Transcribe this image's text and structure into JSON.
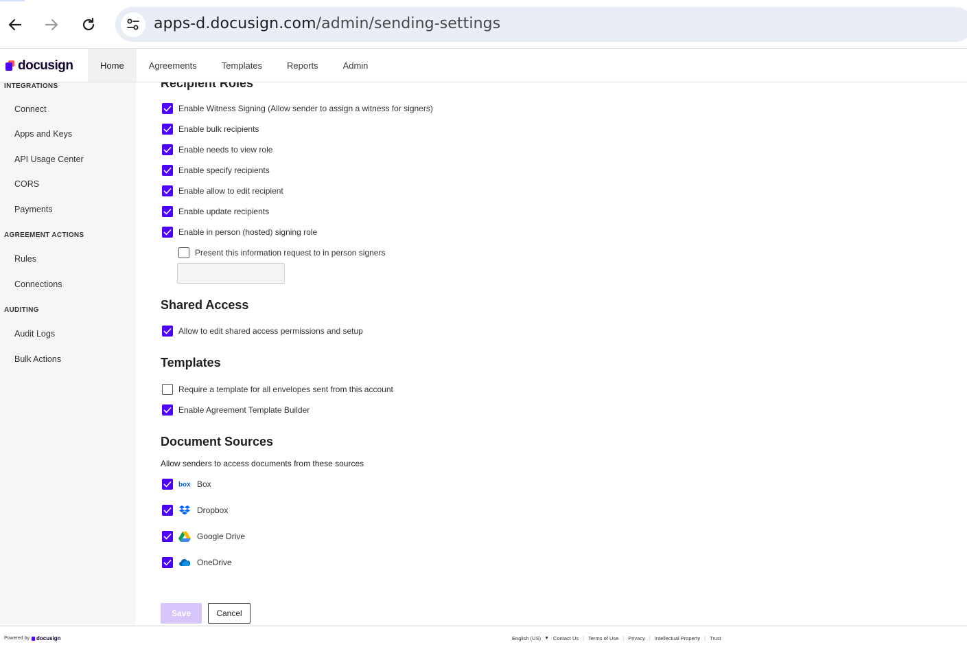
{
  "browser": {
    "url_host": "apps-d.docusign.com",
    "url_path": "/admin/sending-settings"
  },
  "header": {
    "logo_text": "docusign",
    "tabs": [
      {
        "label": "Home",
        "active": true
      },
      {
        "label": "Agreements",
        "active": false
      },
      {
        "label": "Templates",
        "active": false
      },
      {
        "label": "Reports",
        "active": false
      },
      {
        "label": "Admin",
        "active": false
      }
    ]
  },
  "sidebar": {
    "integrations_heading": "INTEGRATIONS",
    "integrations_items": [
      "Connect",
      "Apps and Keys",
      "API Usage Center",
      "CORS",
      "Payments"
    ],
    "agreement_actions_heading": "AGREEMENT ACTIONS",
    "agreement_actions_items": [
      "Rules",
      "Connections"
    ],
    "auditing_heading": "AUDITING",
    "auditing_items": [
      "Audit Logs",
      "Bulk Actions"
    ]
  },
  "recipient_roles": {
    "title": "Recipient Roles",
    "options": [
      {
        "label": "Enable Witness Signing (Allow sender to assign a witness for signers)",
        "checked": true
      },
      {
        "label": "Enable bulk recipients",
        "checked": true
      },
      {
        "label": "Enable needs to view role",
        "checked": true
      },
      {
        "label": "Enable specify recipients",
        "checked": true
      },
      {
        "label": "Enable allow to edit recipient",
        "checked": true
      },
      {
        "label": "Enable update recipients",
        "checked": true
      },
      {
        "label": "Enable in person (hosted) signing role",
        "checked": true
      }
    ],
    "sub_option": {
      "label": "Present this information request to in person signers",
      "checked": false
    },
    "sub_input_value": ""
  },
  "shared_access": {
    "title": "Shared Access",
    "options": [
      {
        "label": "Allow to edit shared access permissions and setup",
        "checked": true
      }
    ]
  },
  "templates": {
    "title": "Templates",
    "options": [
      {
        "label": "Require a template for all envelopes sent from this account",
        "checked": false
      },
      {
        "label": "Enable Agreement Template Builder",
        "checked": true
      }
    ]
  },
  "document_sources": {
    "title": "Document Sources",
    "subtitle": "Allow senders to access documents from these sources",
    "sources": [
      {
        "label": "Box",
        "icon": "box-icon",
        "checked": true
      },
      {
        "label": "Dropbox",
        "icon": "dropbox-icon",
        "checked": true
      },
      {
        "label": "Google Drive",
        "icon": "google-drive-icon",
        "checked": true
      },
      {
        "label": "OneDrive",
        "icon": "onedrive-icon",
        "checked": true
      }
    ]
  },
  "actions": {
    "save_label": "Save",
    "cancel_label": "Cancel"
  },
  "footer": {
    "powered_by": "Powered by",
    "logo_text": "docusign",
    "language": "English (US)",
    "links": [
      "Contact Us",
      "Terms of Use",
      "Privacy",
      "Intellectual Property",
      "Trust"
    ]
  },
  "colors": {
    "accent": "#4c00ff",
    "save_disabled": "#d6c6fb"
  }
}
